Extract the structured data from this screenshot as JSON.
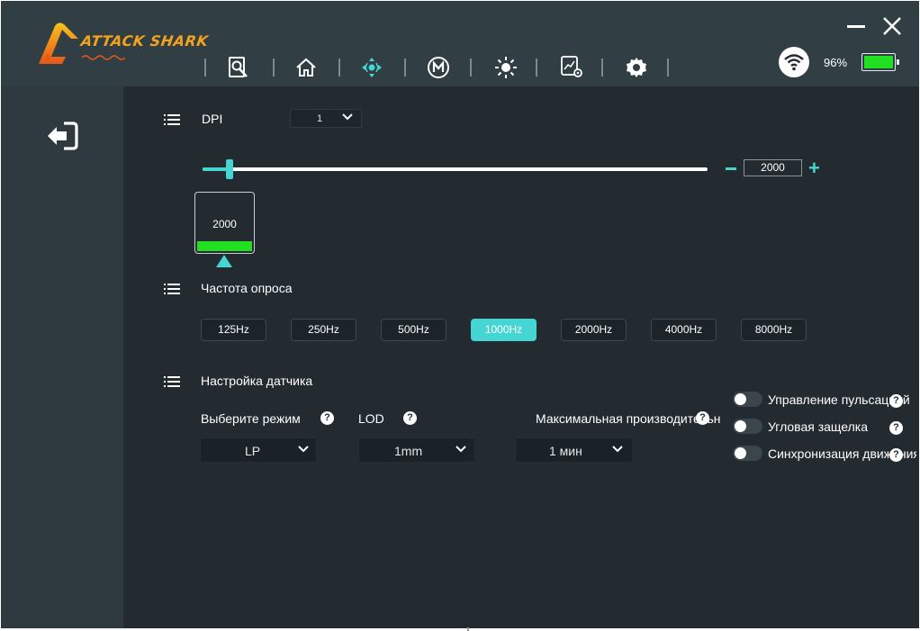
{
  "brand": {
    "name": "ATTACK SHARK",
    "accent": "#45d6d3",
    "logo_color": "#f3a21c"
  },
  "nav": {
    "icons": [
      "search-icon",
      "home-icon",
      "move-icon",
      "macro-icon",
      "brightness-icon",
      "performance-settings-icon",
      "gear-icon"
    ],
    "active": "move-icon"
  },
  "status": {
    "battery_percent": "96%",
    "battery_color": "#22e021",
    "connection": "wifi-icon"
  },
  "dpi": {
    "title": "DPI",
    "profile": "1",
    "value": "2000",
    "level": 0.05,
    "card_value": "2000"
  },
  "polling": {
    "title": "Частота опроса",
    "rates": [
      "125Hz",
      "250Hz",
      "500Hz",
      "1000Hz",
      "2000Hz",
      "4000Hz",
      "8000Hz"
    ],
    "selected": "1000Hz"
  },
  "sensor": {
    "title": "Настройка датчика",
    "mode_label": "Выберите режим",
    "mode_value": "LP",
    "lod_label": "LOD",
    "lod_value": "1mm",
    "perf_label": "Максимальная производительн",
    "perf_value": "1 мин",
    "toggles": [
      {
        "label": "Управление пульсацией",
        "on": false
      },
      {
        "label": "Угловая защелка",
        "on": false
      },
      {
        "label": "Синхронизация движения",
        "on": false
      }
    ],
    "help_glyph": "?"
  }
}
